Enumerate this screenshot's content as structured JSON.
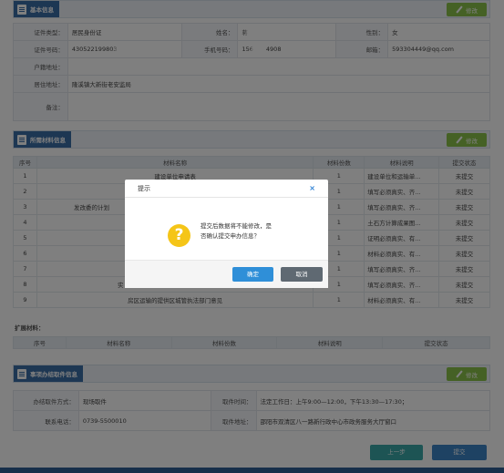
{
  "basic_info": {
    "tab_title": "基本信息",
    "edit_label": "修改",
    "rows": [
      {
        "l1": "证件类型：",
        "v1": "居民身份证",
        "l2": "姓名：",
        "v2": "蒋",
        "l3": "性别：",
        "v3": "女"
      },
      {
        "l1": "证件号码：",
        "v1": "430522199803",
        "l2": "手机号码：",
        "v2a": "156",
        "v2b": "4908",
        "l3": "邮箱：",
        "v3": "593304449@qq.com"
      },
      {
        "l1": "户籍地址：",
        "v1": ""
      },
      {
        "l1": "居住地址：",
        "v1": "隆溪镇大新街老安监局"
      },
      {
        "l1": "备注：",
        "v1": ""
      }
    ]
  },
  "materials": {
    "tab_title": "所需材料信息",
    "edit_label": "修改",
    "headers": [
      "序号",
      "材料名称",
      "材料份数",
      "材料说明",
      "提交状态"
    ],
    "rows": [
      {
        "no": "1",
        "name": "建设单位申请表",
        "count": "1",
        "desc": "建设单位和运输单...",
        "status": "未提交"
      },
      {
        "no": "2",
        "name": "",
        "count": "1",
        "desc": "填写必须真实、齐...",
        "status": "未提交"
      },
      {
        "no": "3",
        "name": "发改委的计划",
        "count": "1",
        "desc": "填写必须真实、齐...",
        "status": "未提交"
      },
      {
        "no": "4",
        "name": "",
        "count": "1",
        "desc": "土石方计算成果图...",
        "status": "未提交"
      },
      {
        "no": "5",
        "name": "",
        "count": "1",
        "desc": "证明必须真实、有...",
        "status": "未提交"
      },
      {
        "no": "6",
        "name": "",
        "count": "1",
        "desc": "材料必须真实、有...",
        "status": "未提交"
      },
      {
        "no": "7",
        "name": "",
        "count": "1",
        "desc": "填写必须真实、齐...",
        "status": "未提交"
      },
      {
        "no": "8",
        "name": "实",
        "count": "1",
        "desc": "填写必须真实、齐...",
        "status": "未提交"
      },
      {
        "no": "9",
        "name": "房区运输的提供区城管执法部门意见",
        "count": "1",
        "desc": "材料必须真实、有...",
        "status": "未提交"
      }
    ]
  },
  "extended": {
    "title": "扩展材料：",
    "headers": [
      "序号",
      "材料名称",
      "材料份数",
      "材料说明",
      "提交状态"
    ]
  },
  "pickup": {
    "tab_title": "事项办结取件信息",
    "edit_label": "修改",
    "rows": [
      {
        "l1": "办结取件方式：",
        "v1": "现场取件",
        "l2": "取件时间：",
        "v2": "法定工作日：上午9:00—12:00，下午13:30—17:30；"
      },
      {
        "l1": "联系电话：",
        "v1": "0739-5500010",
        "l2": "取件地址：",
        "v2": "邵阳市双清区八一路新行政中心市政务服务大厅窗口"
      }
    ]
  },
  "footer": {
    "prev_label": "上一步",
    "submit_label": "提交"
  },
  "dialog": {
    "title": "提示",
    "close_glyph": "×",
    "icon_glyph": "?",
    "message_line1": "提交后数据将不能修改，是",
    "message_line2": "否确认提交申办信息？",
    "ok_label": "确定",
    "cancel_label": "取消"
  },
  "colors": {
    "tab_blue": "#3b6fa6",
    "edit_green": "#8bc34a",
    "status_red": "#d9534f",
    "ok_blue": "#2f8fd8",
    "cancel_gray": "#5f6972",
    "prev_teal": "#3aa9a9",
    "submit_blue": "#3c84c6"
  }
}
